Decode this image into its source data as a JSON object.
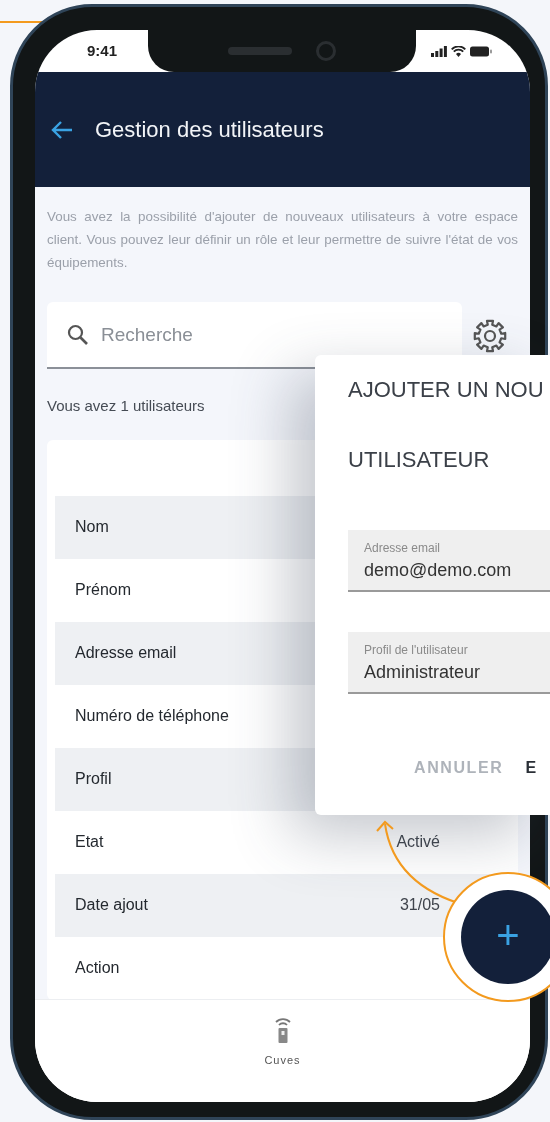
{
  "status_bar": {
    "time": "9:41"
  },
  "header": {
    "title": "Gestion des utilisateurs"
  },
  "intro": "Vous avez la possibilité d'ajouter de nouveaux utilisateurs à votre espace client. Vous pouvez leur définir un rôle et leur permettre de suivre l'état de vos équipements.",
  "search": {
    "placeholder": "Recherche"
  },
  "user_count": "Vous avez 1 utilisateurs",
  "details": [
    {
      "label": "Nom"
    },
    {
      "label": "Prénom"
    },
    {
      "label": "Adresse email"
    },
    {
      "label": "Numéro de téléphone"
    },
    {
      "label": "Profil"
    },
    {
      "label": "Etat",
      "value": "Activé"
    },
    {
      "label": "Date ajout",
      "value": "31/05"
    },
    {
      "label": "Action"
    }
  ],
  "dialog": {
    "title_lines": [
      "AJOUTER UN NOU",
      "UTILISATEUR"
    ],
    "fields": [
      {
        "label": "Adresse email",
        "value": "demo@demo.com"
      },
      {
        "label": "Profil de l'utilisateur",
        "value": "Administrateur"
      }
    ],
    "buttons": [
      {
        "label": "ANNULER",
        "kind": "secondary"
      },
      {
        "label": "E",
        "kind": "primary"
      }
    ]
  },
  "fab": {
    "label": "+"
  },
  "bottom_nav": [
    {
      "label": "Cuves"
    }
  ]
}
